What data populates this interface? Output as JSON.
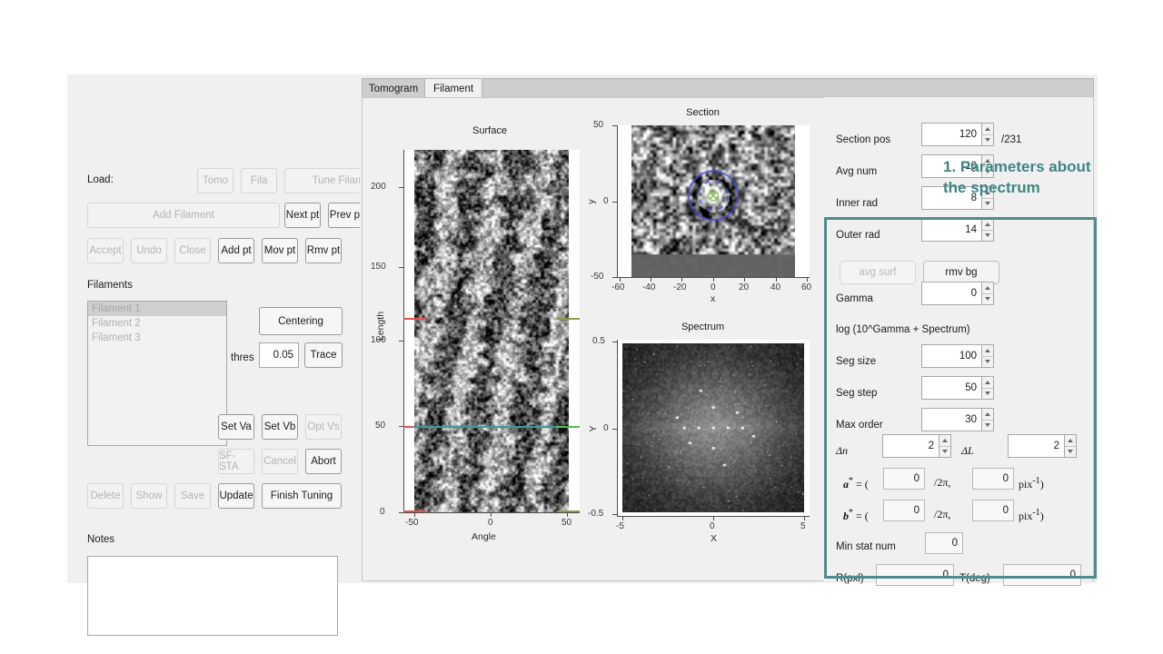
{
  "window": {
    "tabs": [
      {
        "label": "Tomogram",
        "active": false
      },
      {
        "label": "Filament",
        "active": true
      }
    ]
  },
  "left_panel": {
    "load_label": "Load:",
    "buttons_row1": [
      {
        "label": "Tomo",
        "enabled": false
      },
      {
        "label": "Fila",
        "enabled": false
      },
      {
        "label": "Tune Filament",
        "enabled": false
      }
    ],
    "buttons_row2": [
      {
        "label": "Add Filament",
        "enabled": false
      },
      {
        "label": "Next pt",
        "enabled": true
      },
      {
        "label": "Prev pt",
        "enabled": true
      }
    ],
    "buttons_row3": [
      {
        "label": "Accept",
        "enabled": false
      },
      {
        "label": "Undo",
        "enabled": false
      },
      {
        "label": "Close",
        "enabled": false
      },
      {
        "label": "Add pt",
        "enabled": true
      },
      {
        "label": "Mov pt",
        "enabled": true
      },
      {
        "label": "Rmv pt",
        "enabled": true
      }
    ],
    "filaments_label": "Filaments",
    "filament_list": [
      {
        "label": "Filament 1",
        "selected": true
      },
      {
        "label": "Filament 2",
        "selected": false
      },
      {
        "label": "Filament 3",
        "selected": false
      }
    ],
    "centering_label": "Centering",
    "thres_label": "thres",
    "thres_value": "0.05",
    "trace_label": "Trace",
    "buttons_row4": [
      {
        "label": "Set Va",
        "enabled": true
      },
      {
        "label": "Set Vb",
        "enabled": true
      },
      {
        "label": "Opt Vs",
        "enabled": false
      }
    ],
    "buttons_row5": [
      {
        "label": "SF-STA",
        "enabled": false
      },
      {
        "label": "Cancel",
        "enabled": false
      },
      {
        "label": "Abort",
        "enabled": true
      }
    ],
    "buttons_row6": [
      {
        "label": "Delete",
        "enabled": false
      },
      {
        "label": "Show",
        "enabled": false
      },
      {
        "label": "Save",
        "enabled": false
      },
      {
        "label": "Update",
        "enabled": true
      },
      {
        "label": "Finish Tuning",
        "enabled": true
      }
    ],
    "notes_label": "Notes",
    "notes_value": ""
  },
  "plots": {
    "surface": {
      "title": "Surface",
      "xlabel": "Angle",
      "ylabel": "Length",
      "xticks": [
        "-50",
        "0",
        "50"
      ],
      "yticks": [
        "0",
        "50",
        "100",
        "150",
        "200"
      ],
      "marker_left_color": "#e05252",
      "marker_right_color": "#8f9a4d",
      "marker_mid_left_color": "#3d9a9a",
      "marker_mid_right_color": "#4fc04f"
    },
    "section": {
      "title": "Section",
      "xlabel": "x",
      "ylabel": "y",
      "xticks": [
        "-60",
        "-40",
        "-20",
        "0",
        "20",
        "40",
        "60"
      ],
      "yticks": [
        "-50",
        "0",
        "50"
      ],
      "overlay_circle_color": "#4b4bd8",
      "overlay_center_color": "#7ab648"
    },
    "spectrum": {
      "title": "Spectrum",
      "xlabel": "X",
      "ylabel": "Y",
      "xticks": [
        "-5",
        "0",
        "5"
      ],
      "yticks": [
        "-0.5",
        "0",
        "0.5"
      ]
    }
  },
  "param_panel": {
    "rows": [
      {
        "label": "Section pos",
        "value": "120",
        "suffix": "/231",
        "spinner": true
      },
      {
        "label": "Avg num",
        "value": "10",
        "suffix": "",
        "spinner": true
      },
      {
        "label": "Inner rad",
        "value": "8",
        "suffix": "",
        "spinner": true
      },
      {
        "label": "Outer rad",
        "value": "14",
        "suffix": "",
        "spinner": true
      }
    ],
    "avg_surf_label": "avg surf",
    "rmv_bg_label": "rmv bg",
    "gamma_label": "Gamma",
    "gamma_value": "0",
    "log_note": "log (10^Gamma + Spectrum)",
    "seg_rows": [
      {
        "label": "Seg size",
        "value": "100"
      },
      {
        "label": "Seg step",
        "value": "50"
      },
      {
        "label": "Max order",
        "value": "30"
      }
    ],
    "delta_n_label": "Δn",
    "delta_n_value": "2",
    "delta_l_label": "ΔL",
    "delta_l_value": "2",
    "astar_label": "a",
    "astar_eq": " = (",
    "astar_v1": "0",
    "astar_mid": "/2π,",
    "astar_v2": "0",
    "astar_unit": "pix",
    "astar_unit_sup": "-1",
    "astar_close": ")",
    "bstar_label": "b",
    "bstar_v1": "0",
    "bstar_v2": "0",
    "min_stat_label": "Min stat num",
    "min_stat_value": "0",
    "r_label": "R(pxl)",
    "r_value": "0",
    "t_label": "T(deg)",
    "t_value": "0"
  },
  "annotation": {
    "text": "1. Parameters about\nthe spectrum",
    "color": "#3f8585",
    "box_color": "#4f8c8c"
  }
}
